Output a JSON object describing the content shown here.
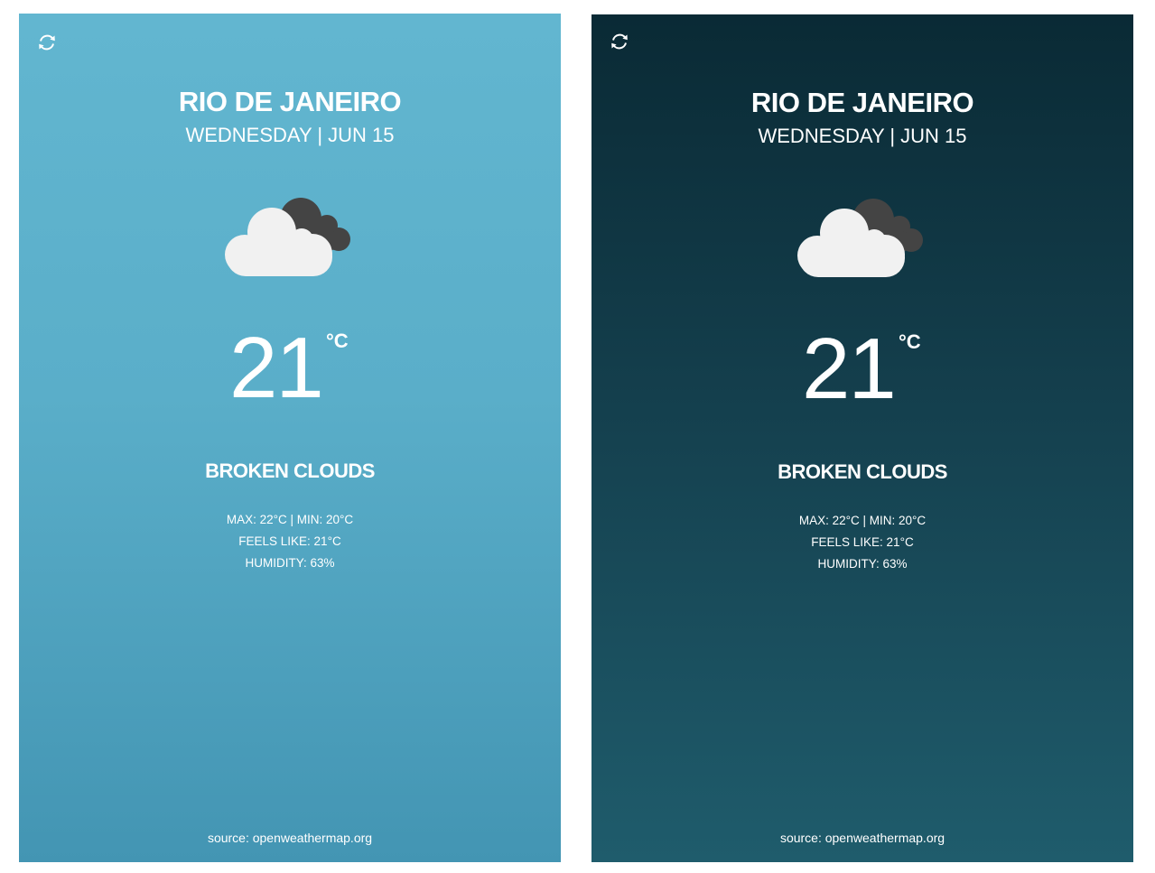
{
  "panels": [
    {
      "theme": "light",
      "refresh_icon": "refresh-icon",
      "city": "RIO DE JANEIRO",
      "date": "WEDNESDAY | JUN 15",
      "weather_icon": "broken-clouds-icon",
      "temperature": "21",
      "unit": "°C",
      "condition": "BROKEN CLOUDS",
      "max_min": "MAX: 22°C | MIN: 20°C",
      "feels_like": "FEELS LIKE: 21°C",
      "humidity": "HUMIDITY: 63%",
      "source": "source: openweathermap.org"
    },
    {
      "theme": "dark",
      "refresh_icon": "refresh-icon",
      "city": "RIO DE JANEIRO",
      "date": "WEDNESDAY | JUN 15",
      "weather_icon": "broken-clouds-icon",
      "temperature": "21",
      "unit": "°C",
      "condition": "BROKEN CLOUDS",
      "max_min": "MAX: 22°C | MIN: 20°C",
      "feels_like": "FEELS LIKE: 21°C",
      "humidity": "HUMIDITY: 63%",
      "source": "source: openweathermap.org"
    }
  ],
  "colors": {
    "light_top": "#62b6d0",
    "light_bottom": "#4395b3",
    "dark_top": "#0a2a35",
    "dark_bottom": "#1f5c6c",
    "cloud_front": "#f1f1f1",
    "cloud_back": "#444444"
  }
}
